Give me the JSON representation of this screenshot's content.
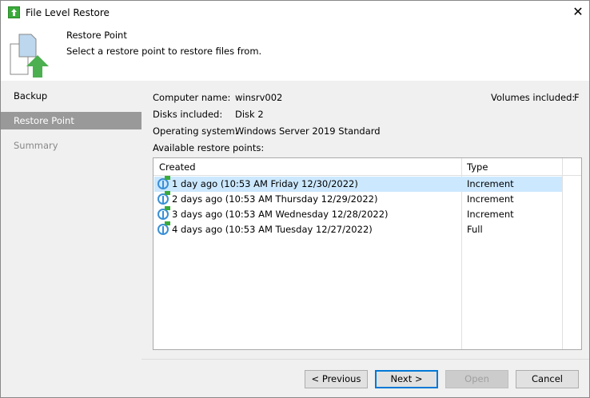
{
  "window": {
    "title": "File Level Restore"
  },
  "header": {
    "title": "Restore Point",
    "subtitle": "Select a restore point to restore files from."
  },
  "sidebar": {
    "items": [
      {
        "label": "Backup"
      },
      {
        "label": "Restore Point"
      },
      {
        "label": "Summary"
      }
    ]
  },
  "info": {
    "computer_label": "Computer name:",
    "computer_value": "winsrv002",
    "disks_label": "Disks included:",
    "disks_value": "Disk 2",
    "os_label": "Operating system:",
    "os_value": "Windows Server 2019 Standard",
    "volumes_label": "Volumes included:",
    "volumes_value": "F",
    "available_label": "Available restore points:"
  },
  "table": {
    "columns": [
      "Created",
      "Type"
    ],
    "rows": [
      {
        "created": "1 day ago (10:53 AM Friday 12/30/2022)",
        "type": "Increment"
      },
      {
        "created": "2 days ago (10:53 AM Thursday 12/29/2022)",
        "type": "Increment"
      },
      {
        "created": "3 days ago (10:53 AM Wednesday 12/28/2022)",
        "type": "Increment"
      },
      {
        "created": "4 days ago (10:53 AM Tuesday 12/27/2022)",
        "type": "Full"
      }
    ]
  },
  "buttons": {
    "previous": "< Previous",
    "next": "Next >",
    "open": "Open",
    "cancel": "Cancel"
  }
}
